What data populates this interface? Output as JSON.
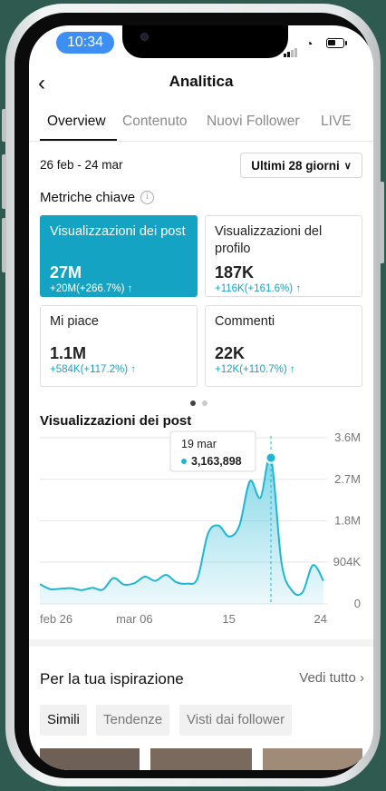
{
  "status": {
    "time": "10:34"
  },
  "nav": {
    "title": "Analitica"
  },
  "tabs": [
    "Overview",
    "Contenuto",
    "Nuovi Follower",
    "LIVE"
  ],
  "date_range": "26 feb - 24 mar",
  "period_select": "Ultimi 28 giorni",
  "key_metrics": {
    "label": "Metriche chiave",
    "cards": [
      {
        "label": "Visualizzazioni dei post",
        "value": "27M",
        "delta": "+20M(+266.7%)",
        "selected": true
      },
      {
        "label": "Visualizzazioni del profilo",
        "value": "187K",
        "delta": "+116K(+161.6%)"
      },
      {
        "label": "Mi piace",
        "value": "1.1M",
        "delta": "+584K(+117.2%)"
      },
      {
        "label": "Commenti",
        "value": "22K",
        "delta": "+12K(+110.7%)"
      }
    ]
  },
  "chart_title": "Visualizzazioni dei post",
  "chart_data": {
    "type": "area",
    "color": "#1fb6d4",
    "y_ticks": [
      "3.6M",
      "2.7M",
      "1.8M",
      "904K",
      "0"
    ],
    "y_tick_values": [
      3600000,
      2700000,
      1800000,
      904000,
      0
    ],
    "ylim": [
      0,
      3600000
    ],
    "x_ticks": [
      "feb 26",
      "mar 06",
      "15",
      "24"
    ],
    "x_tick_dates": [
      "2024-02-26",
      "2024-03-06",
      "2024-03-15",
      "2024-03-24"
    ],
    "series": [
      {
        "x": [
          "2024-02-26",
          "2024-02-27",
          "2024-02-28",
          "2024-02-29",
          "2024-03-01",
          "2024-03-02",
          "2024-03-03",
          "2024-03-04",
          "2024-03-05",
          "2024-03-06",
          "2024-03-07",
          "2024-03-08",
          "2024-03-09",
          "2024-03-10",
          "2024-03-11",
          "2024-03-12",
          "2024-03-13",
          "2024-03-14",
          "2024-03-15",
          "2024-03-16",
          "2024-03-17",
          "2024-03-18",
          "2024-03-19",
          "2024-03-20",
          "2024-03-21",
          "2024-03-22",
          "2024-03-23",
          "2024-03-24"
        ],
        "values": [
          430000,
          320000,
          330000,
          340000,
          300000,
          350000,
          310000,
          560000,
          420000,
          450000,
          590000,
          500000,
          630000,
          470000,
          440000,
          550000,
          1520000,
          1700000,
          1460000,
          1700000,
          2660000,
          2300000,
          3163898,
          900000,
          290000,
          250000,
          840000,
          500000
        ]
      }
    ],
    "tooltip": {
      "label": "19 mar",
      "value": "3,163,898"
    }
  },
  "inspiration": {
    "title": "Per la tua ispirazione",
    "see_all": "Vedi tutto",
    "chips": [
      "Simili",
      "Tendenze",
      "Visti dai follower"
    ]
  }
}
